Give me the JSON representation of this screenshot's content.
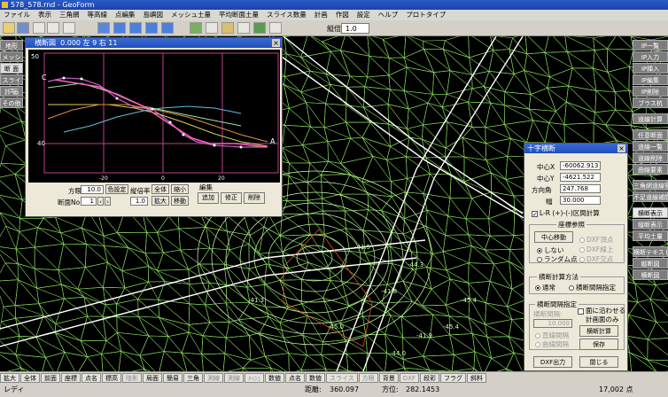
{
  "window": {
    "title": "578_578.rnd - GeoForm"
  },
  "menu": [
    "ファイル",
    "表示",
    "三角網",
    "等高線",
    "点編集",
    "島嶼図",
    "メッシュ土量",
    "平均断面土量",
    "スライス数量",
    "計画",
    "作図",
    "設定",
    "ヘルプ",
    "プロトタイプ"
  ],
  "toolbar": {
    "vscale_label": "縦倍率",
    "vscale_value": "1.0"
  },
  "left_panel": [
    {
      "label": "地形",
      "sel": false
    },
    {
      "label": "メッシュ",
      "sel": false
    },
    {
      "label": "断 面",
      "sel": true
    },
    {
      "label": "スライス",
      "sel": false
    },
    {
      "label": "計 画",
      "sel": false
    },
    {
      "label": "その他",
      "sel": false
    }
  ],
  "right_panel": {
    "group1": [
      "IP一覧",
      "IP入力",
      "IP挿入",
      "IP編集",
      "IP削除",
      "ブラス杭"
    ],
    "group2": [
      "道線計算"
    ],
    "group3": [
      "任意断面",
      "道線一覧",
      "道線削除",
      "曲線要素"
    ],
    "group4": [
      "三角網道線割",
      "不足道線補間"
    ],
    "group5": [
      "横断表示",
      "縦断表示",
      "平均土量"
    ],
    "group6": [
      "横断テキスト",
      "縦断図",
      "横断図"
    ]
  },
  "cross_dialog": {
    "title": "横断図",
    "header": "0.000  左  9  右  11",
    "label_C": "C",
    "label_A": "A",
    "y_ticks": [
      "50",
      "40"
    ],
    "x_ticks": [
      "-20",
      "0",
      "20"
    ],
    "pitch_label": "方眼",
    "pitch_value": "10.0",
    "color_btn": "色設定",
    "vscale_label": "縦倍率",
    "fit_btn": "全体",
    "shrink_btn": "縮小",
    "section_label": "断面No",
    "section_value": "1",
    "vscale_value": "1.0",
    "expand_btn": "拡大",
    "move_btn": "移動",
    "edit_label": "編集",
    "add_btn": "追加",
    "modify_btn": "修正",
    "delete_btn": "削除"
  },
  "juji_dialog": {
    "title": "十字横断",
    "cx_label": "中心X",
    "cx_value": "-60062.913",
    "cy_label": "中心Y",
    "cy_value": "-4621.522",
    "dir_label": "方向角",
    "dir_value": "247.768",
    "width_label": "幅",
    "width_value": "30.000",
    "lr_label": "L-R (+)-(-)区間計算",
    "coord_group": "座標参照",
    "center_move_btn": "中心移動",
    "r_none": "しない",
    "r_random": "ランダム点",
    "r_dxf_point": "DXF頂点",
    "r_dxf_line": "DXF線上",
    "r_dxf_cross": "DXF交点",
    "calc_group": "横断計算方法",
    "r_normal": "通常",
    "r_interval_spec": "横断間隔指定",
    "interval_group": "横断間隔指定",
    "interval_label": "横断間隔:",
    "interval_value": "10.000",
    "r_straight": "直線間隔",
    "r_curve": "曲線間隔",
    "chk_fit": "面に沿わせる",
    "chk_plan": "計画面のみ",
    "calc_btn": "横断計算",
    "save_btn": "保存",
    "dxf_btn": "DXF出力",
    "close_btn": "閉じる"
  },
  "bottom_bar": [
    {
      "t": "拡大",
      "d": false
    },
    {
      "t": "全体",
      "d": false
    },
    {
      "t": "前面",
      "d": false
    },
    {
      "t": "座標",
      "d": false
    },
    {
      "t": "点名",
      "d": false
    },
    {
      "t": "標高",
      "d": false
    },
    {
      "t": "陰影",
      "d": true
    },
    {
      "t": "局面",
      "d": false
    },
    {
      "t": "簡易",
      "d": false
    },
    {
      "t": "三角",
      "d": false
    },
    {
      "t": "測線",
      "d": true
    },
    {
      "t": "測線",
      "d": true
    },
    {
      "t": "ﾒｯｼｭ",
      "d": true
    },
    {
      "t": "数値",
      "d": false
    },
    {
      "t": "点名",
      "d": false
    },
    {
      "t": "数値",
      "d": false
    },
    {
      "t": "スライス",
      "d": true
    },
    {
      "t": "方眼",
      "d": true
    },
    {
      "t": "背景",
      "d": false
    },
    {
      "t": "DXF",
      "d": true
    },
    {
      "t": "段彩",
      "d": false
    },
    {
      "t": "フラグ",
      "d": false
    },
    {
      "t": "斜料",
      "d": false
    }
  ],
  "status": {
    "ready": "レディ",
    "dist_label": "距離:",
    "dist_value": "360.097",
    "dir_label": "方位:",
    "dir_value": "282.1453",
    "count": "17,002 点"
  },
  "canvas_labels": [
    "-41.5",
    "-41.8",
    "-41.9",
    "-41.3",
    "-44.0",
    "-45.4",
    "-44.3",
    "-45.0",
    "-45.4"
  ],
  "colors": {
    "mesh": "#9cff6a",
    "road": "#ffffff",
    "title_blue": "#2050b8"
  }
}
